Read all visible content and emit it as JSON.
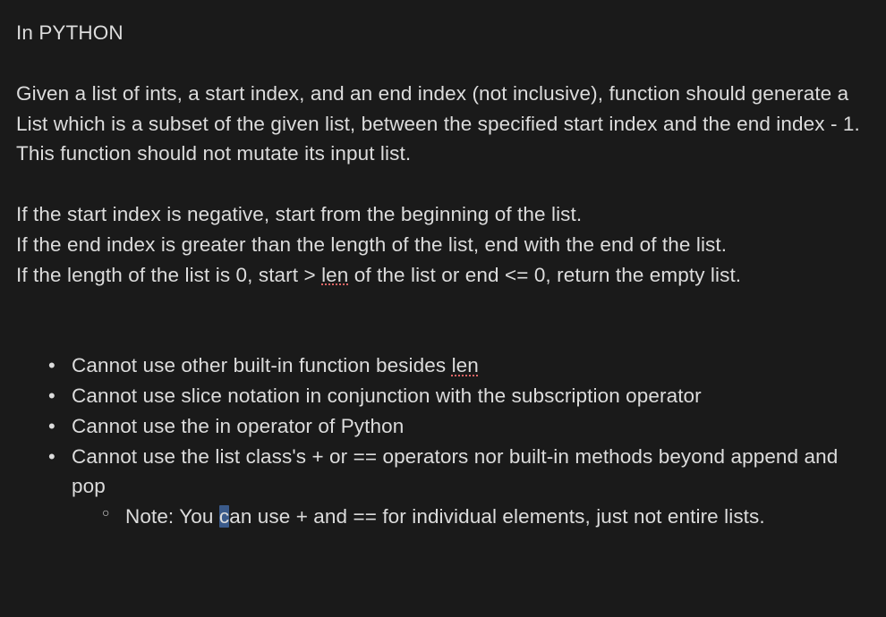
{
  "heading": "In PYTHON",
  "para1": "Given a list of ints, a start index, and an end index (not inclusive), function should generate a List which is a subset of the given list, between the specified start index and the end index - 1. This function should not mutate its input list.",
  "para2_line1": "If the start index is negative, start from the beginning of the list.",
  "para2_line2": "If the end index is greater than the length of the list, end with the end of the list.",
  "para2_line3_pre": "If the length of the list is 0, start > ",
  "para2_line3_err": "len",
  "para2_line3_post": " of the list or end <= 0, return the empty list.",
  "bullets": {
    "b1_pre": "Cannot use other built-in function besides ",
    "b1_err": "len",
    "b2": "Cannot use slice notation in conjunction with the subscription operator",
    "b3": "Cannot use the in operator of Python",
    "b4": "Cannot use the list class's + or == operators nor built-in methods beyond append and pop",
    "sub_pre": "Note: You ",
    "sub_sel": "c",
    "sub_post": "an use + and == for individual elements, just not entire lists."
  }
}
